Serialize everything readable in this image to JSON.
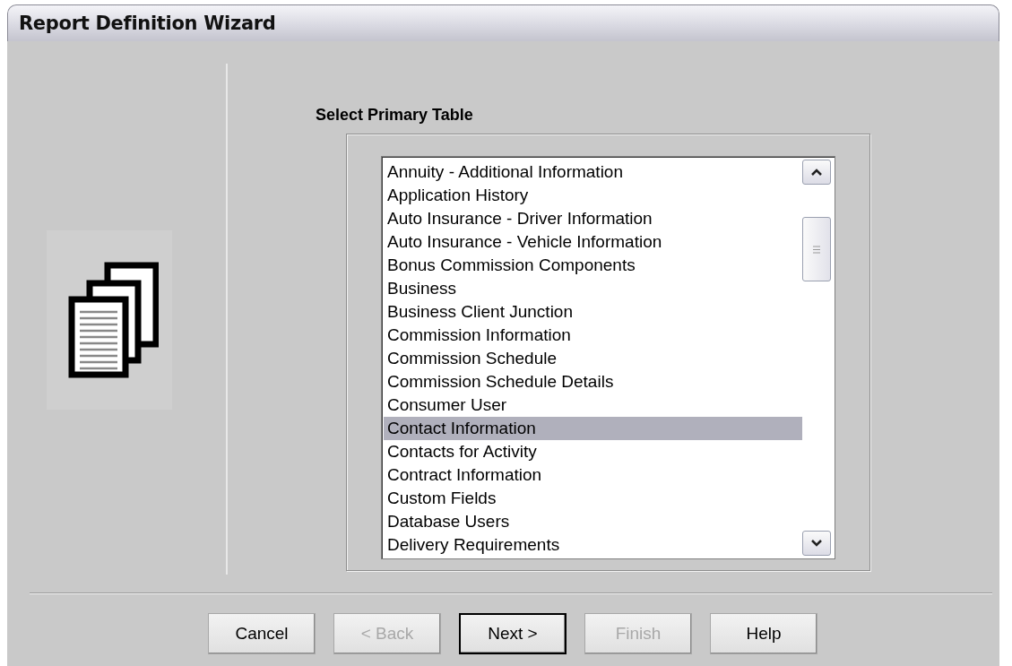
{
  "window": {
    "title": "Report Definition Wizard"
  },
  "heading": "Select Primary Table",
  "tables": [
    {
      "label": "Annuity - Additional Information",
      "selected": false
    },
    {
      "label": "Application History",
      "selected": false
    },
    {
      "label": "Auto Insurance - Driver Information",
      "selected": false
    },
    {
      "label": "Auto Insurance - Vehicle Information",
      "selected": false
    },
    {
      "label": "Bonus Commission Components",
      "selected": false
    },
    {
      "label": "Business",
      "selected": false
    },
    {
      "label": "Business Client Junction",
      "selected": false
    },
    {
      "label": "Commission Information",
      "selected": false
    },
    {
      "label": "Commission Schedule",
      "selected": false
    },
    {
      "label": "Commission Schedule Details",
      "selected": false
    },
    {
      "label": "Consumer User",
      "selected": false
    },
    {
      "label": "Contact Information",
      "selected": true
    },
    {
      "label": "Contacts for Activity",
      "selected": false
    },
    {
      "label": "Contract Information",
      "selected": false
    },
    {
      "label": "Custom Fields",
      "selected": false
    },
    {
      "label": "Database Users",
      "selected": false
    },
    {
      "label": "Delivery Requirements",
      "selected": false
    }
  ],
  "buttons": [
    {
      "label": "Cancel",
      "disabled": false,
      "default": false
    },
    {
      "label": "< Back",
      "disabled": true,
      "default": false
    },
    {
      "label": "Next >",
      "disabled": false,
      "default": true
    },
    {
      "label": "Finish",
      "disabled": true,
      "default": false
    },
    {
      "label": "Help",
      "disabled": false,
      "default": false
    }
  ]
}
